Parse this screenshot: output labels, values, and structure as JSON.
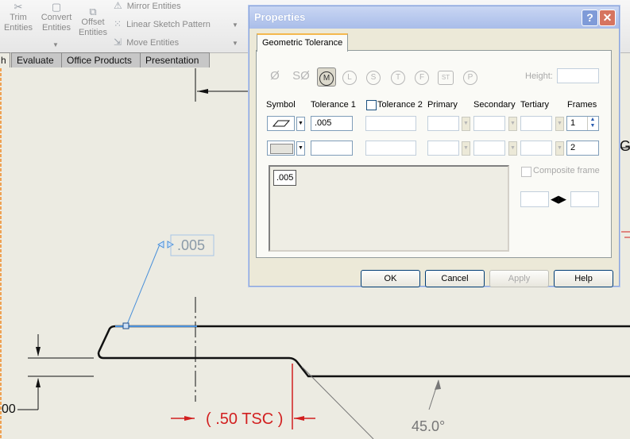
{
  "ribbon": {
    "trim": "Trim\nEntities",
    "convert": "Convert\nEntities",
    "offset": "Offset\nEntities",
    "mirror": "Mirror Entities",
    "linear_pattern": "Linear Sketch Pattern",
    "move": "Move Entities"
  },
  "tabs": [
    "h",
    "Evaluate",
    "Office Products",
    "Presentation"
  ],
  "drawing": {
    "callout_value": ".005",
    "dim_red": "( .50 TSC )",
    "dim_angle": "45.0°",
    "dim_left": "00",
    "letter_right": "G"
  },
  "dialog": {
    "title": "Properties",
    "tab": "Geometric Tolerance",
    "symbols": [
      "Ø",
      "SØ",
      "M",
      "L",
      "S",
      "T",
      "F",
      "ST",
      "P"
    ],
    "height_label": "Height:",
    "height_value": "",
    "columns": {
      "symbol": "Symbol",
      "tol1": "Tolerance 1",
      "tol2": "Tolerance 2",
      "primary": "Primary",
      "secondary": "Secondary",
      "tertiary": "Tertiary",
      "frames": "Frames"
    },
    "row1": {
      "tol1": ".005",
      "tol2": "",
      "primary": "",
      "secondary": "",
      "tertiary": "",
      "frames": "1"
    },
    "row2": {
      "tol1": "",
      "tol2": "",
      "primary": "",
      "secondary": "",
      "tertiary": "",
      "frames": "2"
    },
    "preview_text": ".005",
    "composite_frame": "Composite frame",
    "buttons": {
      "ok": "OK",
      "cancel": "Cancel",
      "apply": "Apply",
      "help": "Help"
    },
    "titlebar_help": "?",
    "titlebar_close": "✕"
  },
  "colors": {
    "title_bar": "#a9bde9",
    "dimension_red": "#d21f1f",
    "callout_blue": "#4a90d9"
  }
}
